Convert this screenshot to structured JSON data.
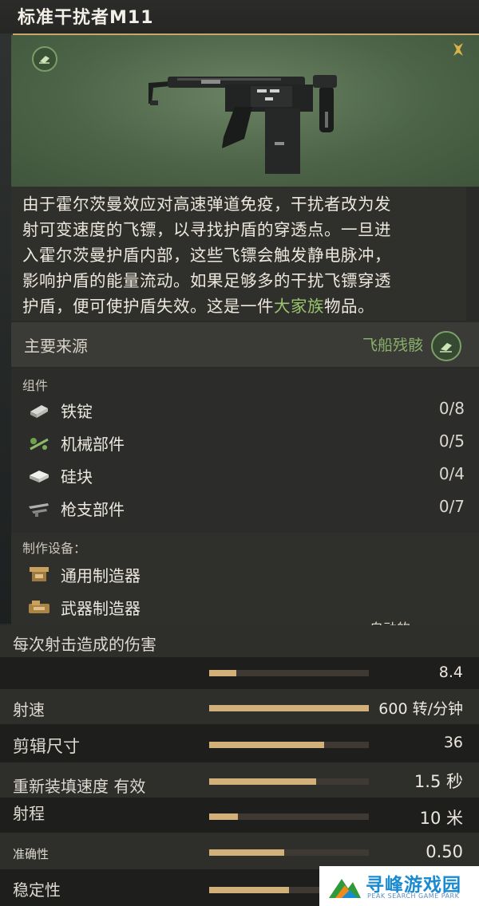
{
  "item": {
    "title": "标准干扰者M11"
  },
  "description": {
    "line1": "由于霍尔茨曼效应对高速弹道免疫，干扰者改为发",
    "line2": "射可变速度的飞镖，以寻找护盾的穿透点。一旦进",
    "line3": "入霍尔茨曼护盾内部，这些飞镖会触发静电脉冲，",
    "line4": "影响护盾的能量流动。如果足够多的干扰飞镖穿透",
    "line5_before": "护盾，便可使护盾失效。这是一件",
    "line5_highlight": "大家族",
    "line5_after": "物品。"
  },
  "source": {
    "label": "主要来源",
    "value": "飞船残骸"
  },
  "components": {
    "label": "组件",
    "items": [
      {
        "name": "铁锭",
        "count": "0/8",
        "icon": "iron-ingot-icon"
      },
      {
        "name": "机械部件",
        "count": "0/5",
        "icon": "mechanical-parts-icon"
      },
      {
        "name": "硅块",
        "count": "0/4",
        "icon": "silicon-block-icon"
      },
      {
        "name": "枪支部件",
        "count": "0/7",
        "icon": "gun-parts-icon"
      }
    ]
  },
  "crafting": {
    "label": "制作设备：",
    "items": [
      {
        "name": "通用制造器",
        "icon": "fabricator-icon"
      },
      {
        "name": "武器制造器",
        "icon": "weapon-fabricator-icon"
      }
    ]
  },
  "stats": {
    "cut_text": "自动的",
    "rows": [
      {
        "label": "每次射击造成的伤害",
        "value": "",
        "fill": null
      },
      {
        "label": "",
        "value": "8.4",
        "fill": 0.17
      },
      {
        "label": "射速",
        "value": "600 转/分钟",
        "fill": 1.0
      },
      {
        "label": "剪辑尺寸",
        "value": "36",
        "fill": 0.72
      },
      {
        "label": "重新装填速度 有效",
        "value": "1.5 秒",
        "fill": 0.67
      },
      {
        "label": "射程",
        "value": "10 米",
        "fill": 0.18
      },
      {
        "label": "准确性",
        "value": "0.50",
        "fill": 0.47
      },
      {
        "label": "稳定性",
        "value": "",
        "fill": 0.5
      }
    ]
  },
  "watermark": {
    "name": "寻峰游戏园",
    "sub": "PEAK SEARCH GAME PARK"
  },
  "colors": {
    "accent_gold": "#c8a86a",
    "highlight_green": "#9bc46e",
    "bar_fill": "#d2b07a"
  }
}
